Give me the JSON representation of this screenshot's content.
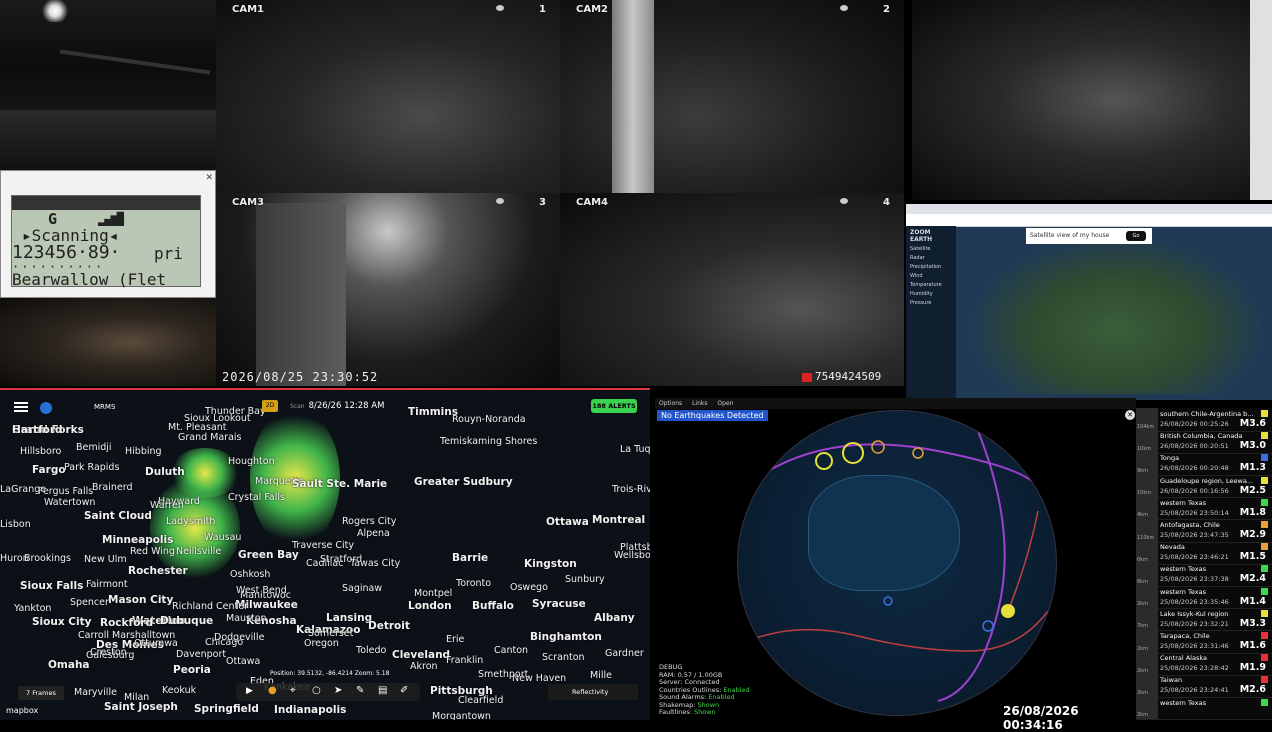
{
  "scanner": {
    "signal_label": "G",
    "signal_bars": "▂▄▆█",
    "status": "▸Scanning◂",
    "frequency": "123456·89·",
    "priority": "pri",
    "separator": "··········",
    "channel_name": "Bearwallow (Flet"
  },
  "cameras": [
    {
      "label": "CAM1",
      "number": "1"
    },
    {
      "label": "CAM2",
      "number": "2"
    },
    {
      "label": "CAM3",
      "number": "3"
    },
    {
      "label": "CAM4",
      "number": "4"
    }
  ],
  "nvr": {
    "timestamp": "2026/08/25 23:30:52",
    "device_id": "7549424509"
  },
  "zoom_earth": {
    "brand": "ZOOM EARTH",
    "search_text": "Satellite view of my house",
    "search_button": "Go",
    "layers": [
      "Satellite",
      "Radar",
      "Precipitation",
      "Wind",
      "Temperature",
      "Humidity",
      "Pressure"
    ]
  },
  "radar": {
    "product": "MRMS",
    "mode": "2D",
    "scan_label": "Scan",
    "scan_time": "8/26/26 12:28 AM",
    "alerts": "188 ALERTS",
    "position": "Position: 39.5132, -86.4214  Zoom: 5.18",
    "frames": "7 Frames",
    "layer": "Reflectivity",
    "attribution": "mapbox",
    "cities": [
      "Grand Forks",
      "Thunder Bay",
      "Timmins",
      "Rouyn-Noranda",
      "Bemidji",
      "Grand Marais",
      "Temiskaming Shores",
      "La Tuque",
      "Hillsboro",
      "Hibbing",
      "Fargo",
      "Park Rapids",
      "Duluth",
      "Houghton",
      "Marquette",
      "Sault Ste. Marie",
      "Greater Sudbury",
      "Fergus Falls",
      "Brainerd",
      "Hayward",
      "Crystal Falls",
      "Trois-Riv",
      "Saint Cloud",
      "Ladysmith",
      "Wausau",
      "Rogers City",
      "Alpena",
      "Ottawa",
      "Montreal",
      "Minneapolis",
      "Red Wing",
      "Neillsville",
      "Traverse City",
      "Cadillac",
      "Barrie",
      "Plattsburgh",
      "Rochester",
      "Green Bay",
      "Oshkosh",
      "Tawas City",
      "Kingston",
      "Sioux Falls",
      "Fairmont",
      "Mason City",
      "Manitowoc",
      "Saginaw",
      "Toronto",
      "Oswego",
      "Syracuse",
      "Milwaukee",
      "Kenosha",
      "Lansing",
      "London",
      "Buffalo",
      "Waterloo",
      "Dubuque",
      "Rockford",
      "Chicago",
      "Kalamazoo",
      "Detroit",
      "Albany",
      "Sioux City",
      "Des Moines",
      "Davenport",
      "Ottawa",
      "Toledo",
      "Cleveland",
      "Erie",
      "Binghamton",
      "Omaha",
      "Galesburg",
      "Peoria",
      "Akron",
      "Franklin",
      "Scranton",
      "Pittsburgh",
      "Springfield",
      "Indianapolis",
      "Saint Joseph",
      "Morgantown",
      "Huron",
      "Brookings",
      "New Ulm",
      "Yankton",
      "Spencer",
      "Carroll",
      "Marshalltown",
      "Creston",
      "Ottumwa",
      "Maryville",
      "Milan",
      "Keokuk",
      "Kankakee",
      "Richland Center",
      "West Bend",
      "Mauston",
      "Dodgeville",
      "Oregon",
      "LaGrange",
      "Watertown",
      "Lisbon",
      "Warren",
      "Gardner",
      "New Haven",
      "Sunbury",
      "Canton",
      "Smethport",
      "Clearfield",
      "Somerset",
      "Wellsboro",
      "Montpel",
      "Stratford",
      "Mt. Pleasant",
      "Sioux Lookout",
      "Eden",
      "Mille",
      "Hartford"
    ]
  },
  "quake_monitor": {
    "menu": [
      "Options",
      "Links",
      "Open"
    ],
    "banner": "No Earthquakes Detected",
    "status_lines": [
      {
        "label": "DEBUG",
        "value": ""
      },
      {
        "label": "RAM: 0.57 / 1.00GB",
        "value": ""
      },
      {
        "label": "Server: Connected",
        "value": ""
      },
      {
        "label": "Countries Outlines: ",
        "value": "Enabled"
      },
      {
        "label": "Sound Alarms: ",
        "value": "Enabled"
      },
      {
        "label": "Shakemap: ",
        "value": "Shown"
      },
      {
        "label": "Faultlines: ",
        "value": "Shown"
      }
    ],
    "clock": "26/08/2026 00:34:16"
  },
  "quake_list": [
    {
      "dist": "104km",
      "location": "southern Chile-Argentina b...",
      "time": "26/08/2026 00:25:26",
      "mag": "M3.6",
      "color": "#e8e03a"
    },
    {
      "dist": "10km",
      "location": "British Columbia, Canada",
      "time": "26/08/2026 00:20:51",
      "mag": "M3.0",
      "color": "#e8e03a"
    },
    {
      "dist": "9km",
      "location": "Tonga",
      "time": "26/08/2026 00:20:48",
      "mag": "M1.3",
      "color": "#3b6fe0"
    },
    {
      "dist": "10km",
      "location": "Guadeloupe region, Leewa...",
      "time": "26/08/2026 00:16:56",
      "mag": "M2.5",
      "color": "#e8e03a"
    },
    {
      "dist": "4km",
      "location": "western Texas",
      "time": "25/08/2026 23:50:14",
      "mag": "M1.8",
      "color": "#3dd94c"
    },
    {
      "dist": "110km",
      "location": "Antofagasta, Chile",
      "time": "25/08/2026 23:47:35",
      "mag": "M2.9",
      "color": "#e8a03a"
    },
    {
      "dist": "0km",
      "location": "Nevada",
      "time": "25/08/2026 23:46:21",
      "mag": "M1.5",
      "color": "#e8a03a"
    },
    {
      "dist": "8km",
      "location": "western Texas",
      "time": "25/08/2026 23:37:38",
      "mag": "M2.4",
      "color": "#3dd94c"
    },
    {
      "dist": "2km",
      "location": "western Texas",
      "time": "25/08/2026 23:35:46",
      "mag": "M1.4",
      "color": "#3dd94c"
    },
    {
      "dist": "7km",
      "location": "Lake Issyk-Kul region",
      "time": "25/08/2026 23:32:21",
      "mag": "M3.3",
      "color": "#e8e03a"
    },
    {
      "dist": "2km",
      "location": "Tarapaca, Chile",
      "time": "25/08/2026 23:31:46",
      "mag": "M1.6",
      "color": "#e8303a"
    },
    {
      "dist": "2km",
      "location": "Central Alaska",
      "time": "25/08/2026 23:28:42",
      "mag": "M1.9",
      "color": "#e8303a"
    },
    {
      "dist": "2km",
      "location": "Taiwan",
      "time": "25/08/2026 23:24:41",
      "mag": "M2.6",
      "color": "#e8303a"
    },
    {
      "dist": "2km",
      "location": "western Texas",
      "time": "",
      "mag": "",
      "color": "#3dd94c"
    }
  ],
  "colors": {
    "alerts_green": "#3ad34f",
    "banner_blue": "#2255cc",
    "status_green": "#3dd94c"
  }
}
